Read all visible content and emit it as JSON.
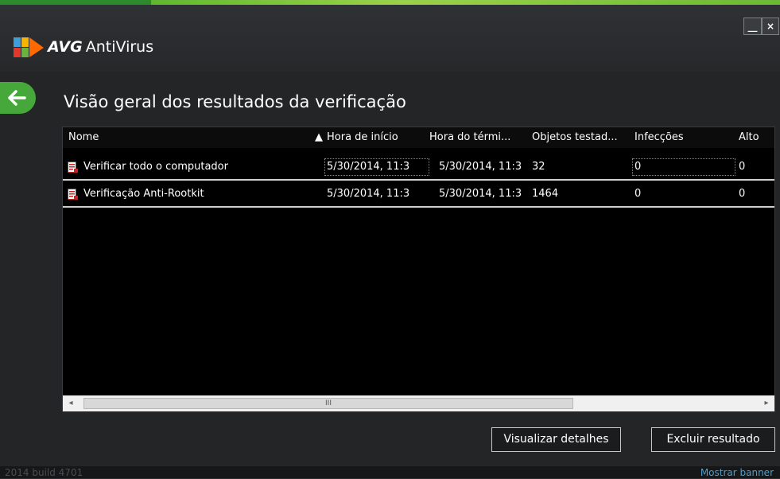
{
  "app": {
    "brand": "AVG",
    "product": "AntiVirus",
    "minimize_label": "__",
    "close_label": "×"
  },
  "page": {
    "title": "Visão geral dos resultados da verificação"
  },
  "table": {
    "columns": [
      "Nome",
      "Hora de início",
      "Hora do térmi...",
      "Objetos testad...",
      "Infecções",
      "Alto"
    ],
    "sort_indicator": "▲",
    "rows": [
      {
        "name": "Verificar todo o computador",
        "start": "5/30/2014, 11:3",
        "end": "5/30/2014, 11:3",
        "objects": "32",
        "infections": "0",
        "high": "0"
      },
      {
        "name": "Verificação Anti-Rootkit",
        "start": "5/30/2014, 11:3",
        "end": "5/30/2014, 11:3",
        "objects": "1464",
        "infections": "0",
        "high": "0"
      }
    ]
  },
  "scrollbar": {
    "left_arrow": "◂",
    "right_arrow": "▸",
    "grip": "III"
  },
  "actions": {
    "view_details": "Visualizar detalhes",
    "delete_result": "Excluir resultado"
  },
  "footer": {
    "build": "2014  build 4701",
    "show_banner": "Mostrar banner"
  },
  "colors": {
    "accent_green": "#46a73a",
    "link_blue": "#4e9ec9",
    "background": "#232527"
  },
  "icons": [
    "avg-logo-icon",
    "back-arrow-icon",
    "scan-report-icon",
    "sort-ascending-icon"
  ]
}
